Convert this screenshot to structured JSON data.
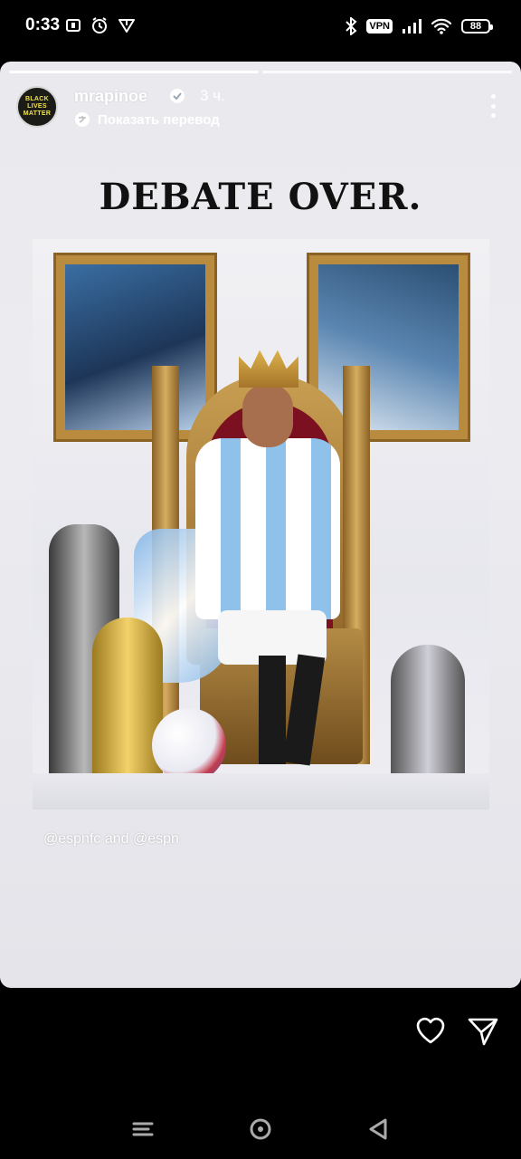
{
  "status_bar": {
    "time": "0:33",
    "vpn_label": "VPN",
    "battery_level": "88",
    "left_icons": [
      "data-saver-icon",
      "alarm-icon",
      "heart-notification-icon"
    ],
    "right_icons": [
      "bluetooth-icon",
      "vpn-icon",
      "signal-icon",
      "wifi-icon",
      "battery-icon"
    ]
  },
  "story": {
    "progress_segments": 2,
    "current_segment": 2,
    "author": {
      "username": "mrapinoe",
      "verified": true,
      "time_ago": "3 ч.",
      "avatar_text": [
        "BLACK",
        "LIVES",
        "MATTER"
      ]
    },
    "translate_label": "Показать перевод",
    "headline": "DEBATE OVER.",
    "credit": "@espnfc and @espn"
  },
  "actions": {
    "like_icon": "heart-outline-icon",
    "share_icon": "paper-plane-icon"
  },
  "navigation": {
    "buttons": [
      "menu-icon",
      "home-icon",
      "back-icon"
    ]
  },
  "colors": {
    "background": "#000000",
    "story_bg": "#e9e9ee",
    "headline": "#111111",
    "text_on_story": "#ffffff"
  }
}
